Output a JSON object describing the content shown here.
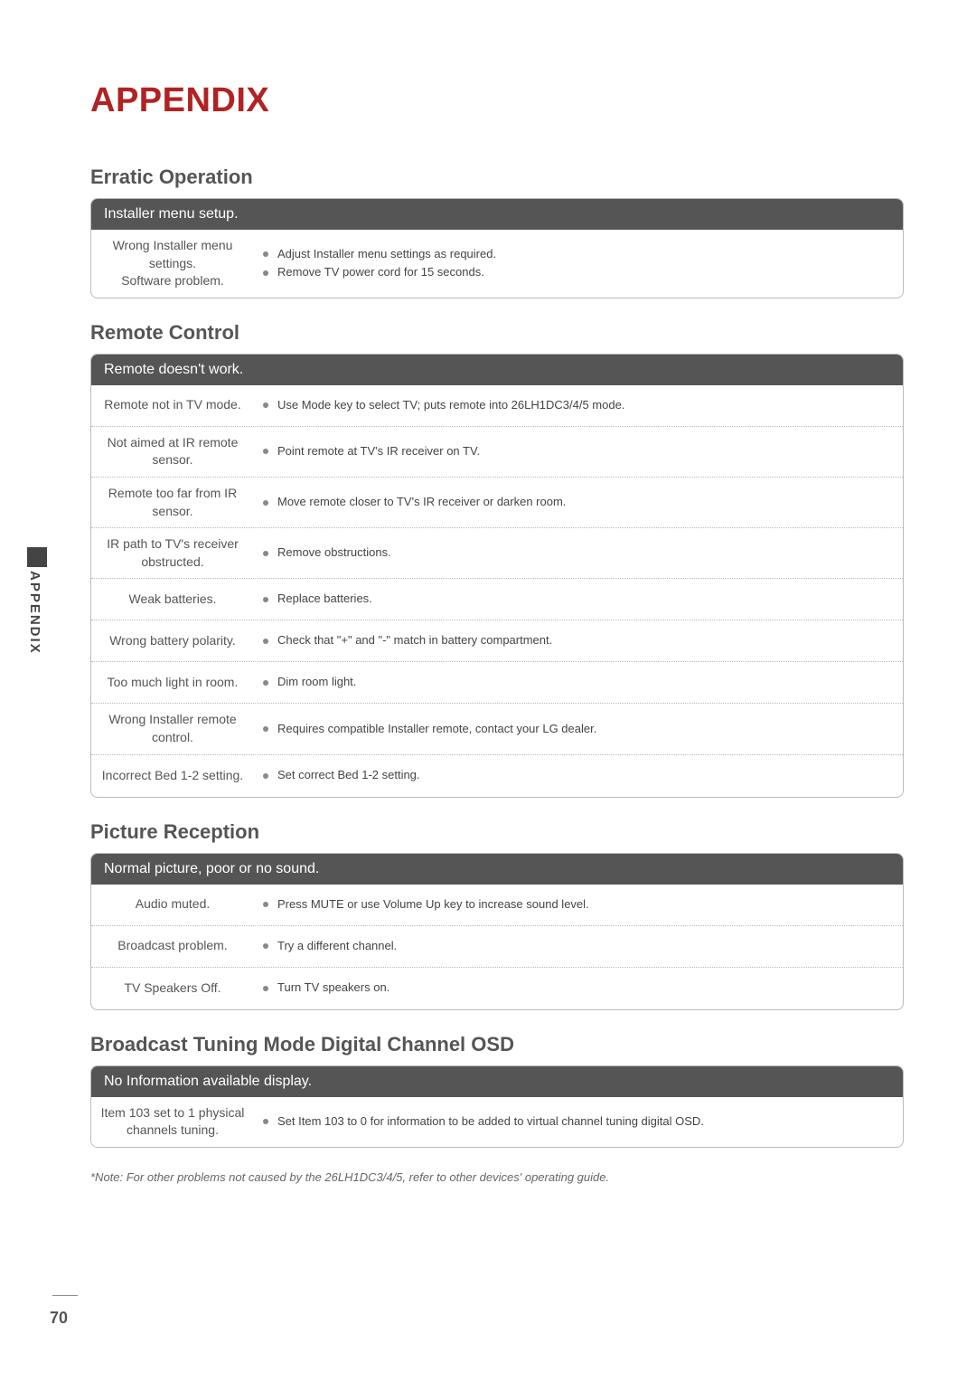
{
  "title": "APPENDIX",
  "sidebar_label": "APPENDIX",
  "page_number": "70",
  "footnote": "*Note: For other problems not caused by the 26LH1DC3/4/5, refer to other devices' operating guide.",
  "sections": [
    {
      "heading": "Erratic Operation",
      "panel_head": "Installer menu setup.",
      "rows": [
        {
          "left": "Wrong Installer menu settings.\nSoftware problem.",
          "bullets": [
            "Adjust Installer menu settings as required.",
            "Remove TV power cord for 15 seconds."
          ]
        }
      ]
    },
    {
      "heading": "Remote Control",
      "panel_head": "Remote doesn't work.",
      "rows": [
        {
          "left": "Remote not in TV mode.",
          "bullets": [
            "Use Mode key to select TV; puts remote into 26LH1DC3/4/5 mode."
          ]
        },
        {
          "left": "Not aimed at IR remote sensor.",
          "bullets": [
            "Point remote at TV's IR receiver on TV."
          ]
        },
        {
          "left": "Remote too far from IR sensor.",
          "bullets": [
            "Move remote closer to TV's IR receiver or darken room."
          ]
        },
        {
          "left": "IR path to TV's receiver obstructed.",
          "bullets": [
            "Remove obstructions."
          ]
        },
        {
          "left": "Weak batteries.",
          "bullets": [
            "Replace batteries."
          ]
        },
        {
          "left": "Wrong battery polarity.",
          "bullets": [
            "Check that \"+\" and \"-\" match in battery compartment."
          ]
        },
        {
          "left": "Too much light in room.",
          "bullets": [
            "Dim room light."
          ]
        },
        {
          "left": "Wrong Installer remote control.",
          "bullets": [
            "Requires compatible Installer remote, contact your LG dealer."
          ]
        },
        {
          "left": "Incorrect Bed 1-2 setting.",
          "bullets": [
            "Set correct Bed 1-2 setting."
          ]
        }
      ]
    },
    {
      "heading": "Picture Reception",
      "panel_head": "Normal picture, poor or no sound.",
      "rows": [
        {
          "left": "Audio muted.",
          "bullets": [
            "Press MUTE or use Volume Up key to increase sound level."
          ]
        },
        {
          "left": "Broadcast problem.",
          "bullets": [
            "Try a different channel."
          ]
        },
        {
          "left": "TV Speakers Off.",
          "bullets": [
            "Turn TV speakers on."
          ]
        }
      ]
    },
    {
      "heading": "Broadcast Tuning Mode Digital Channel OSD",
      "panel_head": "No Information available display.",
      "rows": [
        {
          "left": "Item 103 set to 1 physical channels tuning.",
          "bullets": [
            "Set Item 103 to 0 for information to be added to virtual channel tuning digital OSD."
          ]
        }
      ]
    }
  ]
}
